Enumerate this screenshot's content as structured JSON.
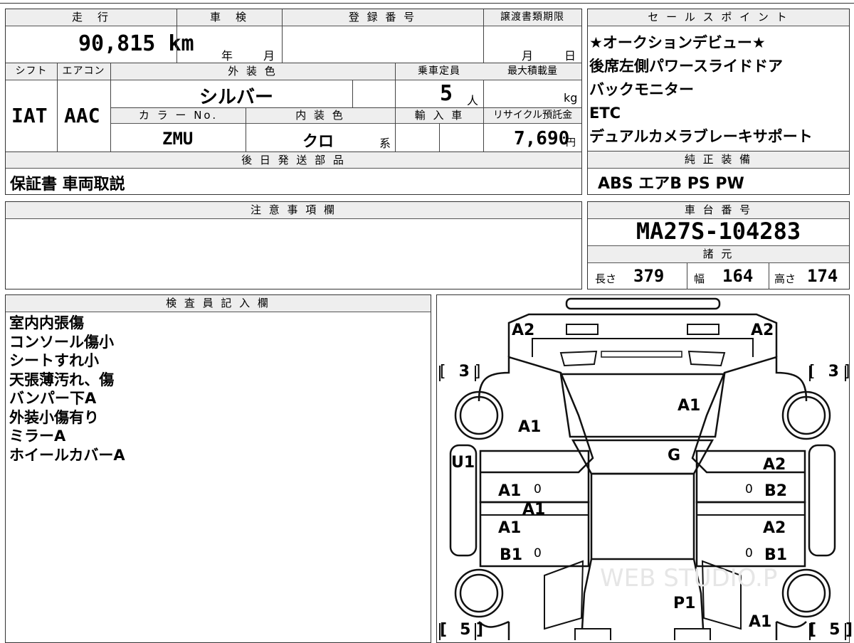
{
  "vehicle": {
    "mileage_header": "走　行",
    "mileage": "90,815",
    "mileage_unit": "km",
    "inspection_header": "車　検",
    "inspection_year_label": "年",
    "inspection_month_label": "月",
    "registration_header": "登 録 番 号",
    "deadline_header": "譲渡書類期限",
    "deadline_month_label": "月",
    "deadline_day_label": "日",
    "shift_header": "シフト",
    "shift": "IAT",
    "ac_header": "エアコン",
    "ac": "AAC",
    "exterior_color_header": "外 装 色",
    "exterior_color": "シルバー",
    "capacity_header": "乗車定員",
    "capacity": "5",
    "capacity_unit": "人",
    "max_load_header": "最大積載量",
    "max_load_unit": "kg",
    "color_no_header": "カ ラ ー No.",
    "color_no": "ZMU",
    "interior_color_header": "内 装 色",
    "interior_color": "クロ",
    "interior_color_suffix": "系",
    "import_header": "輸 入 車",
    "recycle_header": "リサイクル預託金",
    "recycle_fee": "7,690",
    "recycle_unit": "円",
    "later_parts_header": "後 日 発 送 部 品",
    "later_parts": "保証書 車両取説"
  },
  "sales": {
    "header": "セ ー ル ス ポ イ ン ト",
    "points": [
      "★オークションデビュー★",
      "後席左側パワースライドドア",
      "バックモニター",
      "ETC",
      "デュアルカメラブレーキサポート"
    ],
    "equipment_header": "純 正 装 備",
    "equipment": "ABS エアB PS PW"
  },
  "notes": {
    "header": "注 意 事 項 欄",
    "text": ""
  },
  "chassis": {
    "header": "車 台 番 号",
    "number": "MA27S-104283",
    "specs_header": "諸 元",
    "length_label": "長さ",
    "length": "379",
    "width_label": "幅",
    "width": "164",
    "height_label": "高さ",
    "height": "174"
  },
  "inspector": {
    "header": "検 査 員 記 入 欄",
    "lines": [
      "室内内張傷",
      "コンソール傷小",
      "シートすれ小",
      "天張薄汚れ、傷",
      "バンパー下A",
      "外装小傷有り",
      "ミラーA",
      "ホイールカバーA"
    ]
  },
  "diagram": {
    "marks": {
      "front_left": "A2",
      "front_right": "A2",
      "tire_fl": "3",
      "tire_fr": "3",
      "hood": "A1",
      "left_fender": "A1",
      "left_mirror": "U1",
      "windshield": "G",
      "right_front_door_a": "A2",
      "right_front_door_b": "B2",
      "left_front_door": "A1",
      "left_pillar": "A1",
      "left_rear_door_a": "A1",
      "left_rear_door_b": "B1",
      "right_rear_door_a": "A2",
      "right_rear_door_b": "B1",
      "rear": "P1",
      "rear_right": "A1",
      "tire_rl": "5",
      "tire_rr": "5",
      "door_zero": "0"
    },
    "watermark": "WEB STUDIO.P"
  }
}
